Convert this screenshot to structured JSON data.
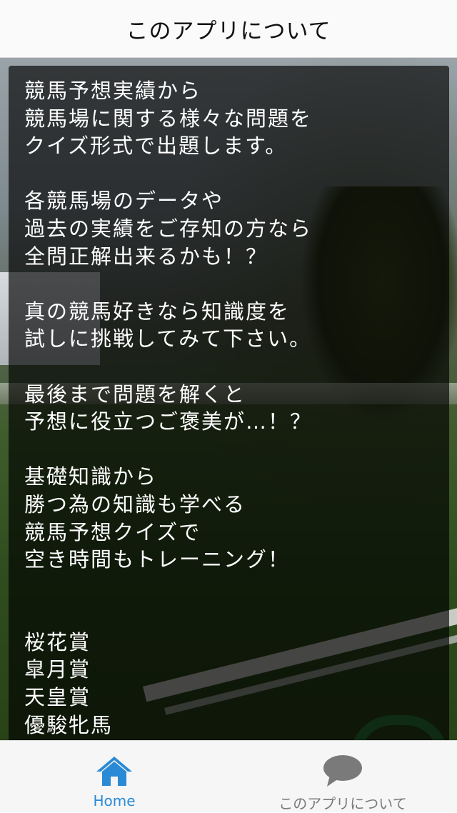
{
  "header": {
    "title": "このアプリについて"
  },
  "content": {
    "body_text": "競馬予想実績から\n競馬場に関する様々な問題を\nクイズ形式で出題します。\n\n各競馬場のデータや\n過去の実績をご存知の方なら\n全問正解出来るかも！？\n\n真の競馬好きなら知識度を\n試しに挑戦してみて下さい。\n\n最後まで問題を解くと\n予想に役立つご褒美が…！？\n\n基礎知識から\n勝つ為の知識も学べる\n競馬予想クイズで\n空き時間もトレーニング！\n\n\n桜花賞\n皐月賞\n天皇賞\n優駿牝馬"
  },
  "tabbar": {
    "tabs": [
      {
        "label": "Home",
        "icon": "home-icon",
        "active": true
      },
      {
        "label": "このアプリについて",
        "icon": "chat-bubble-icon",
        "active": false
      }
    ]
  },
  "colors": {
    "active_tab": "#2a8ad6",
    "inactive_tab": "#7a7a7a",
    "overlay": "#000000"
  }
}
